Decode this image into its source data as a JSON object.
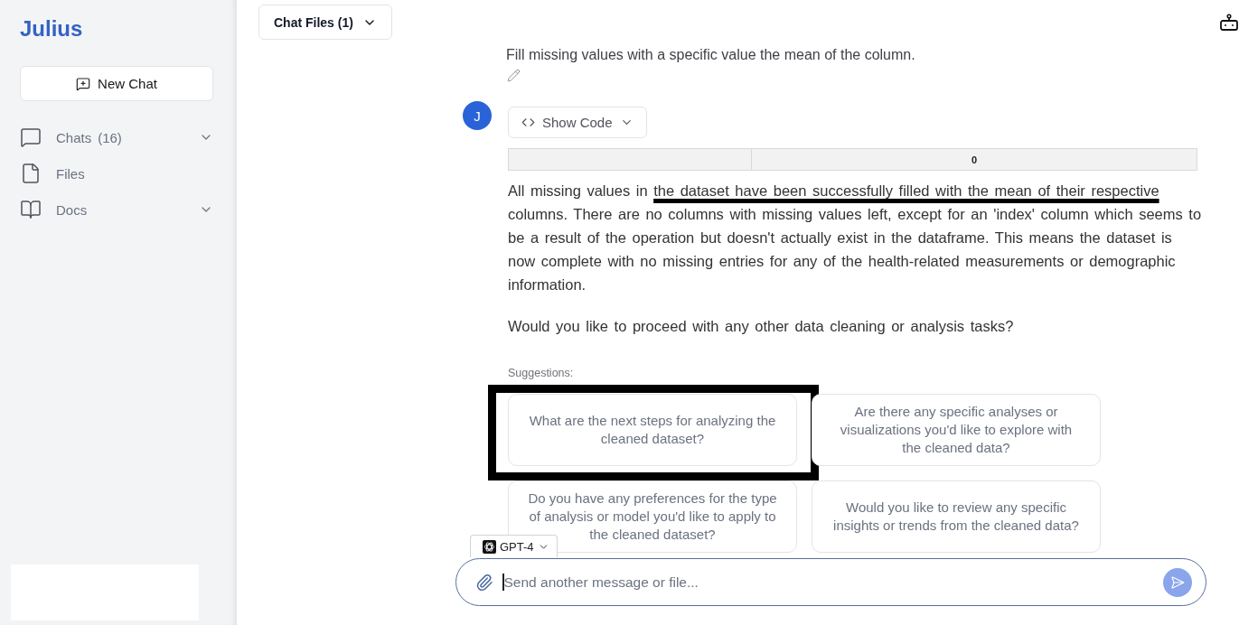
{
  "sidebar": {
    "logo": "Julius",
    "new_chat_button": "New Chat",
    "items": [
      {
        "kind": "chats",
        "label": "Chats",
        "count": "(16)",
        "collapsible": true
      },
      {
        "kind": "files",
        "label": "Files",
        "collapsible": false
      },
      {
        "kind": "docs",
        "label": "Docs",
        "collapsible": true
      }
    ]
  },
  "header": {
    "chat_files_button": "Chat Files (1)"
  },
  "conversation": {
    "user_message": "Fill missing values with a specific value the mean of the column.",
    "assistant": {
      "avatar_initial": "J",
      "show_code_button": "Show Code",
      "table": {
        "header_cells": [
          {
            "kind": "index"
          },
          {
            "kind": "value",
            "label": "0"
          }
        ]
      },
      "paragraphs": [
        {
          "segments": [
            {
              "text": "All missing values in ",
              "underlined": false
            },
            {
              "text": "the dataset have been successfully filled with the mean of their respective",
              "underlined": true
            },
            {
              "text": " columns. There are no columns with missing values left, except for an 'index' column which seems to be a result of the operation but doesn't actually exist in the dataframe. This means the dataset is now complete with no missing entries for any of the health-related measurements or demographic information.",
              "underlined": false
            }
          ]
        },
        {
          "segments": [
            {
              "text": "Would you like to proceed with any other data cleaning or analysis tasks?",
              "underlined": false
            }
          ]
        }
      ]
    }
  },
  "suggestions": {
    "label": "Suggestions:",
    "items": [
      {
        "text": "What are the next steps for analyzing the cleaned dataset?",
        "framed": true
      },
      {
        "text": "Are there any specific analyses or visualizations you'd like to explore with the cleaned data?",
        "framed": false
      },
      {
        "text": "Do you have any preferences for the type of analysis or model you'd like to apply to the cleaned dataset?",
        "framed": false
      },
      {
        "text": "Would you like to review any specific insights or trends from the cleaned data?",
        "framed": false
      }
    ]
  },
  "composer": {
    "model": "GPT-4",
    "placeholder": "Send another message or file...",
    "focused": true,
    "send_disabled": true
  }
}
